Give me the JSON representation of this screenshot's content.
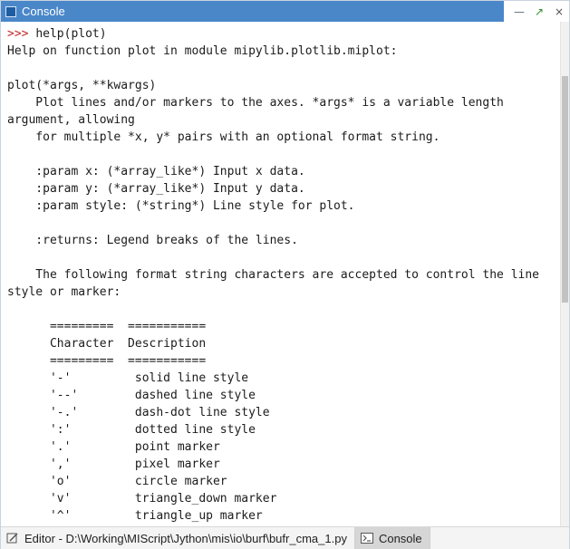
{
  "window": {
    "title": "Console",
    "buttons": {
      "minimize": "—",
      "restore": "↗",
      "close": "×"
    }
  },
  "console": {
    "lines": [
      {
        "prompt": ">>> ",
        "text": "help(plot)"
      },
      {
        "prompt": "",
        "text": "Help on function plot in module mipylib.plotlib.miplot:"
      },
      {
        "prompt": "",
        "text": ""
      },
      {
        "prompt": "",
        "text": "plot(*args, **kwargs)"
      },
      {
        "prompt": "",
        "text": "    Plot lines and/or markers to the axes. *args* is a variable length"
      },
      {
        "prompt": "",
        "text": "argument, allowing"
      },
      {
        "prompt": "",
        "text": "    for multiple *x, y* pairs with an optional format string."
      },
      {
        "prompt": "",
        "text": ""
      },
      {
        "prompt": "",
        "text": "    :param x: (*array_like*) Input x data."
      },
      {
        "prompt": "",
        "text": "    :param y: (*array_like*) Input y data."
      },
      {
        "prompt": "",
        "text": "    :param style: (*string*) Line style for plot."
      },
      {
        "prompt": "",
        "text": ""
      },
      {
        "prompt": "",
        "text": "    :returns: Legend breaks of the lines."
      },
      {
        "prompt": "",
        "text": ""
      },
      {
        "prompt": "",
        "text": "    The following format string characters are accepted to control the line"
      },
      {
        "prompt": "",
        "text": "style or marker:"
      },
      {
        "prompt": "",
        "text": ""
      },
      {
        "prompt": "",
        "text": "      =========  ==========="
      },
      {
        "prompt": "",
        "text": "      Character  Description"
      },
      {
        "prompt": "",
        "text": "      =========  ==========="
      },
      {
        "prompt": "",
        "text": "      '-'         solid line style"
      },
      {
        "prompt": "",
        "text": "      '--'        dashed line style"
      },
      {
        "prompt": "",
        "text": "      '-.'        dash-dot line style"
      },
      {
        "prompt": "",
        "text": "      ':'         dotted line style"
      },
      {
        "prompt": "",
        "text": "      '.'         point marker"
      },
      {
        "prompt": "",
        "text": "      ','         pixel marker"
      },
      {
        "prompt": "",
        "text": "      'o'         circle marker"
      },
      {
        "prompt": "",
        "text": "      'v'         triangle_down marker"
      },
      {
        "prompt": "",
        "text": "      '^'         triangle_up marker"
      }
    ]
  },
  "tabs": [
    {
      "label": "Editor - D:\\Working\\MIScript\\Jython\\mis\\io\\burf\\bufr_cma_1.py",
      "icon": "editor-icon",
      "active": false
    },
    {
      "label": "Console",
      "icon": "console-icon",
      "active": true
    }
  ]
}
